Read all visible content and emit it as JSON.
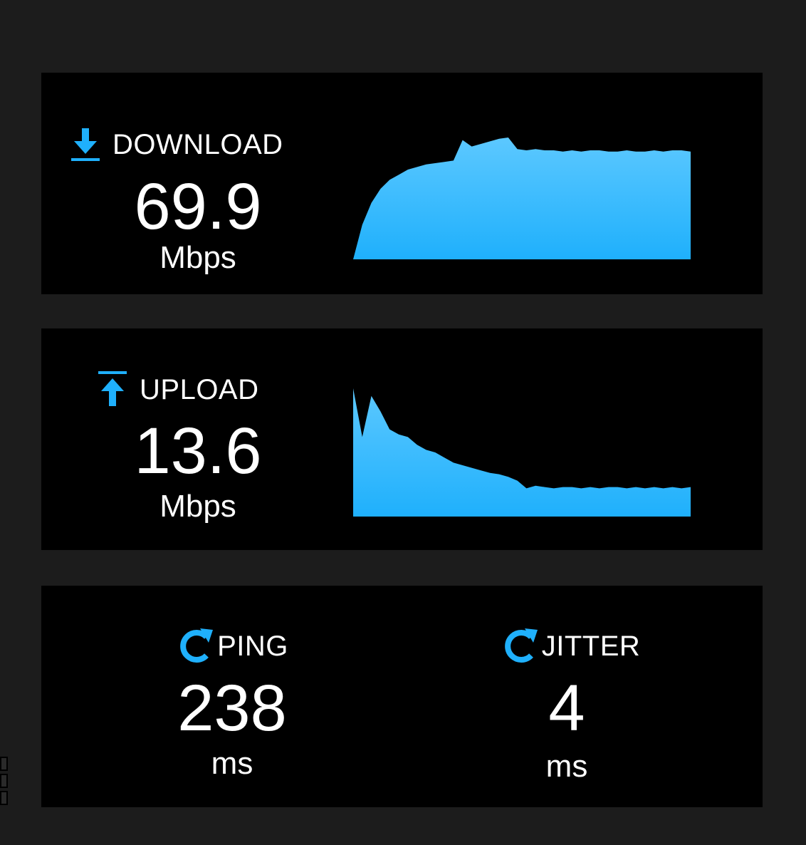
{
  "colors": {
    "accent": "#1fb0fc",
    "accent_light": "#5cc8ff",
    "page_background": "#1c1c1c",
    "card_background": "#000000",
    "text": "#ffffff"
  },
  "download": {
    "icon": "download-arrow-icon",
    "label": "DOWNLOAD",
    "value": "69.9",
    "unit": "Mbps",
    "graph_relative_values": [
      0,
      0.27,
      0.44,
      0.55,
      0.62,
      0.66,
      0.7,
      0.72,
      0.74,
      0.75,
      0.76,
      0.77,
      0.93,
      0.88,
      0.9,
      0.92,
      0.94,
      0.95,
      0.86,
      0.85,
      0.86,
      0.85,
      0.85,
      0.84,
      0.85,
      0.84,
      0.85,
      0.85,
      0.84,
      0.84,
      0.85,
      0.84,
      0.84,
      0.85,
      0.84,
      0.85,
      0.85,
      0.84
    ]
  },
  "upload": {
    "icon": "upload-arrow-icon",
    "label": "UPLOAD",
    "value": "13.6",
    "unit": "Mbps",
    "graph_relative_values": [
      1.0,
      0.62,
      0.94,
      0.82,
      0.68,
      0.64,
      0.62,
      0.56,
      0.52,
      0.5,
      0.46,
      0.42,
      0.4,
      0.38,
      0.36,
      0.34,
      0.33,
      0.31,
      0.28,
      0.22,
      0.24,
      0.23,
      0.22,
      0.23,
      0.23,
      0.22,
      0.23,
      0.22,
      0.23,
      0.23,
      0.22,
      0.23,
      0.22,
      0.23,
      0.22,
      0.23,
      0.22,
      0.23
    ]
  },
  "ping": {
    "icon": "refresh-icon",
    "label": "PING",
    "value": "238",
    "unit": "ms"
  },
  "jitter": {
    "icon": "refresh-icon",
    "label": "JITTER",
    "value": "4",
    "unit": "ms"
  }
}
